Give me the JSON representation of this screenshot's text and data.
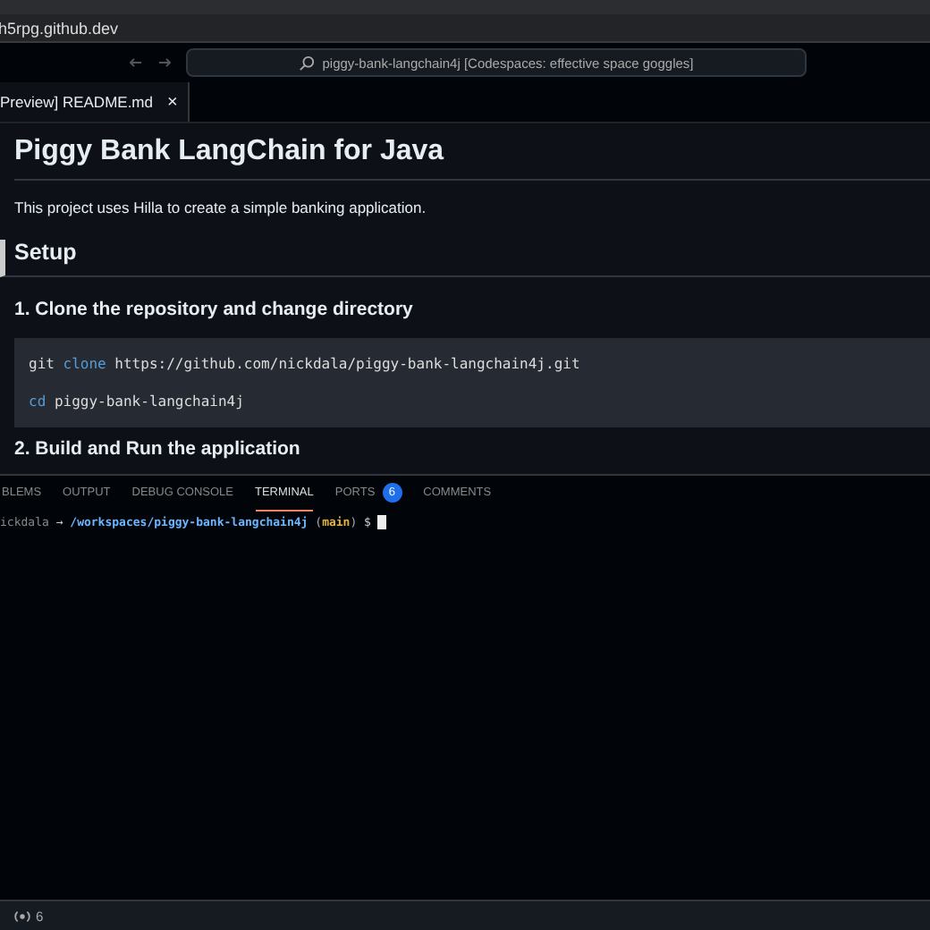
{
  "browser": {
    "url": "h5rpg.github.dev"
  },
  "title_bar": {
    "search": "piggy-bank-langchain4j [Codespaces: effective space goggles]"
  },
  "tabs": [
    {
      "label": "Preview] README.md",
      "selected": true,
      "close": "×"
    }
  ],
  "document": {
    "title": "Piggy Bank LangChain for Java",
    "intro": "This project uses Hilla to create a simple banking application.",
    "section": "Setup",
    "step": "1. Clone the repository and change directory",
    "code": [
      {
        "cmd": "git",
        "keyword": "clone",
        "rest": "https://github.com/nickdala/piggy-bank-langchain4j.git"
      },
      {
        "keyword": "cd",
        "rest": "piggy-bank-langchain4j"
      }
    ],
    "next_step": "2. Build and Run the application"
  },
  "panel_tabs": [
    {
      "label": "BLEMS",
      "selected": false
    },
    {
      "label": "OUTPUT",
      "selected": false
    },
    {
      "label": "DEBUG CONSOLE",
      "selected": false
    },
    {
      "label": "TERMINAL",
      "selected": true
    },
    {
      "label": "PORTS",
      "selected": false,
      "badge": "6"
    },
    {
      "label": "COMMENTS",
      "selected": false
    }
  ],
  "terminal": {
    "user": "ickdala",
    "arrow": "→",
    "path": "/workspaces/piggy-bank-langchain4j",
    "branch_open": "(",
    "branch": "main",
    "branch_close": ")",
    "prompt": "$"
  },
  "status_bar": {
    "ports": "6"
  }
}
